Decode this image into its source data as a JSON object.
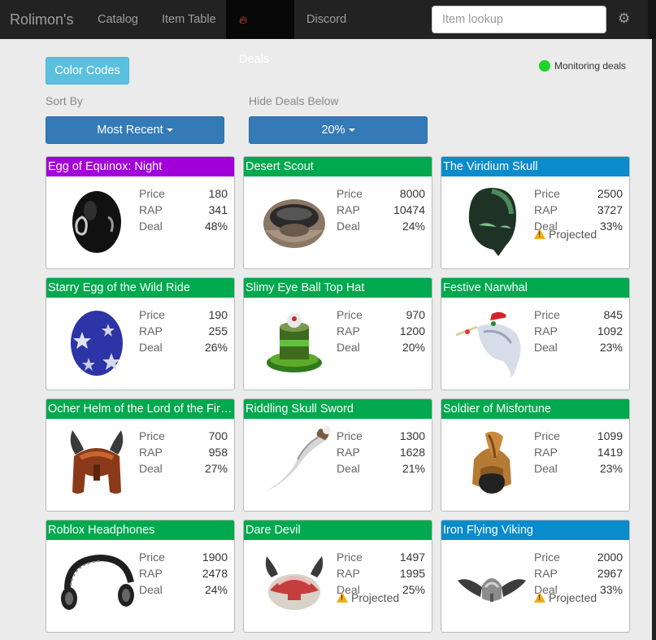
{
  "nav": {
    "brand": "Rolimon's",
    "links": [
      "Catalog",
      "Item Table",
      "Deals",
      "Discord"
    ],
    "search_placeholder": "Item lookup",
    "settings_icon": "gear-icon"
  },
  "controls": {
    "color_codes_label": "Color Codes",
    "monitoring_text": "Monitoring deals",
    "monitoring_color": "#1ed32a",
    "sort_by_label": "Sort By",
    "sort_by_value": "Most Recent",
    "hide_deals_label": "Hide Deals Below",
    "hide_deals_value": "20%"
  },
  "stat_labels": {
    "price": "Price",
    "rap": "RAP",
    "deal": "Deal"
  },
  "projected_label": "Projected",
  "header_colors": {
    "purple": "#a100d9",
    "green": "#00a84e",
    "blue": "#0a8bcc"
  },
  "deals": [
    {
      "name": "Egg of Equinox: Night",
      "price": "180",
      "rap": "341",
      "deal": "48%",
      "color": "purple",
      "projected": false,
      "icon": "black-egg"
    },
    {
      "name": "Desert Scout",
      "price": "8000",
      "rap": "10474",
      "deal": "24%",
      "color": "green",
      "projected": false,
      "icon": "desert-scout"
    },
    {
      "name": "The Viridium Skull",
      "price": "2500",
      "rap": "3727",
      "deal": "33%",
      "color": "blue",
      "projected": true,
      "icon": "green-skull"
    },
    {
      "name": "Starry Egg of the Wild Ride",
      "price": "190",
      "rap": "255",
      "deal": "26%",
      "color": "green",
      "projected": false,
      "icon": "starry-egg"
    },
    {
      "name": "Slimy Eye Ball Top Hat",
      "price": "970",
      "rap": "1200",
      "deal": "20%",
      "color": "green",
      "projected": false,
      "icon": "slimy-hat"
    },
    {
      "name": "Festive Narwhal",
      "price": "845",
      "rap": "1092",
      "deal": "23%",
      "color": "green",
      "projected": false,
      "icon": "narwhal"
    },
    {
      "name": "Ocher Helm of the Lord of the Fire…",
      "price": "700",
      "rap": "958",
      "deal": "27%",
      "color": "green",
      "projected": false,
      "icon": "horned-helm"
    },
    {
      "name": "Riddling Skull Sword",
      "price": "1300",
      "rap": "1628",
      "deal": "21%",
      "color": "green",
      "projected": false,
      "icon": "sword"
    },
    {
      "name": "Soldier of Misfortune",
      "price": "1099",
      "rap": "1419",
      "deal": "23%",
      "color": "green",
      "projected": false,
      "icon": "soldier-helm"
    },
    {
      "name": "Roblox Headphones",
      "price": "1900",
      "rap": "2478",
      "deal": "24%",
      "color": "green",
      "projected": false,
      "icon": "headphones"
    },
    {
      "name": "Dare Devil",
      "price": "1497",
      "rap": "1995",
      "deal": "25%",
      "color": "green",
      "projected": true,
      "icon": "dare-devil"
    },
    {
      "name": "Iron Flying Viking",
      "price": "2000",
      "rap": "2967",
      "deal": "33%",
      "color": "blue",
      "projected": true,
      "icon": "winged-helm"
    }
  ]
}
